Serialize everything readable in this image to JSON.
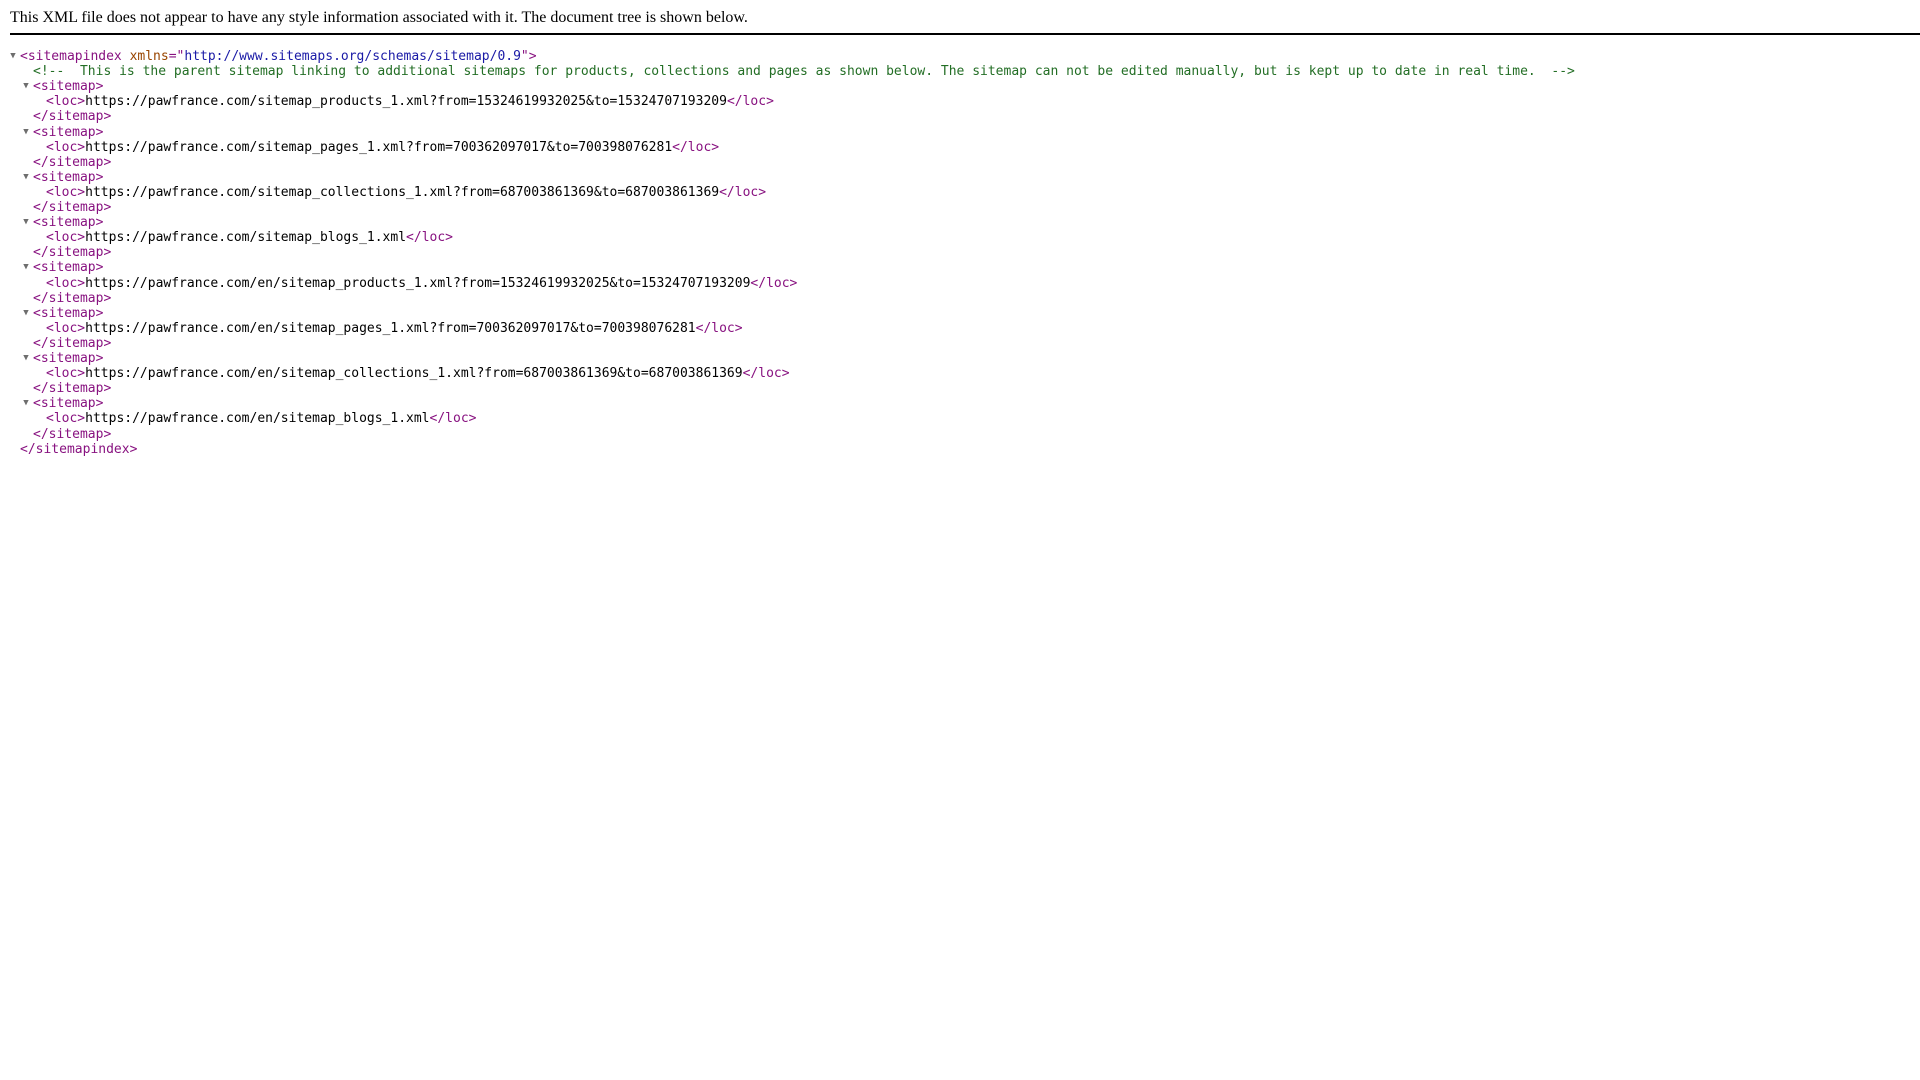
{
  "info_message": "This XML file does not appear to have any style information associated with it. The document tree is shown below.",
  "colors": {
    "tag": "#881280",
    "attribute_name": "#994500",
    "attribute_value": "#1a1aa6",
    "comment": "#236e25",
    "text": "#000000",
    "toggle": "#6e6e6e"
  },
  "icons": {
    "collapse": "triangle-down-icon"
  },
  "root": {
    "open_tag": "<sitemapindex",
    "attr_name": "xmlns",
    "attr_eq_quote": "=\"",
    "attr_value": "http://www.sitemaps.org/schemas/sitemap/0.9",
    "attr_close": "\">",
    "close_tag": "</sitemapindex>",
    "comment": "<!--  This is the parent sitemap linking to additional sitemaps for products, collections and pages as shown below. The sitemap can not be edited manually, but is kept up to date in real time.  -->"
  },
  "sitemap_open": "<sitemap>",
  "sitemap_close": "</sitemap>",
  "loc_open": "<loc>",
  "loc_close": "</loc>",
  "sitemaps": [
    {
      "loc": "https://pawfrance.com/sitemap_products_1.xml?from=15324619932025&to=15324707193209"
    },
    {
      "loc": "https://pawfrance.com/sitemap_pages_1.xml?from=700362097017&to=700398076281"
    },
    {
      "loc": "https://pawfrance.com/sitemap_collections_1.xml?from=687003861369&to=687003861369"
    },
    {
      "loc": "https://pawfrance.com/sitemap_blogs_1.xml"
    },
    {
      "loc": "https://pawfrance.com/en/sitemap_products_1.xml?from=15324619932025&to=15324707193209"
    },
    {
      "loc": "https://pawfrance.com/en/sitemap_pages_1.xml?from=700362097017&to=700398076281"
    },
    {
      "loc": "https://pawfrance.com/en/sitemap_collections_1.xml?from=687003861369&to=687003861369"
    },
    {
      "loc": "https://pawfrance.com/en/sitemap_blogs_1.xml"
    }
  ]
}
